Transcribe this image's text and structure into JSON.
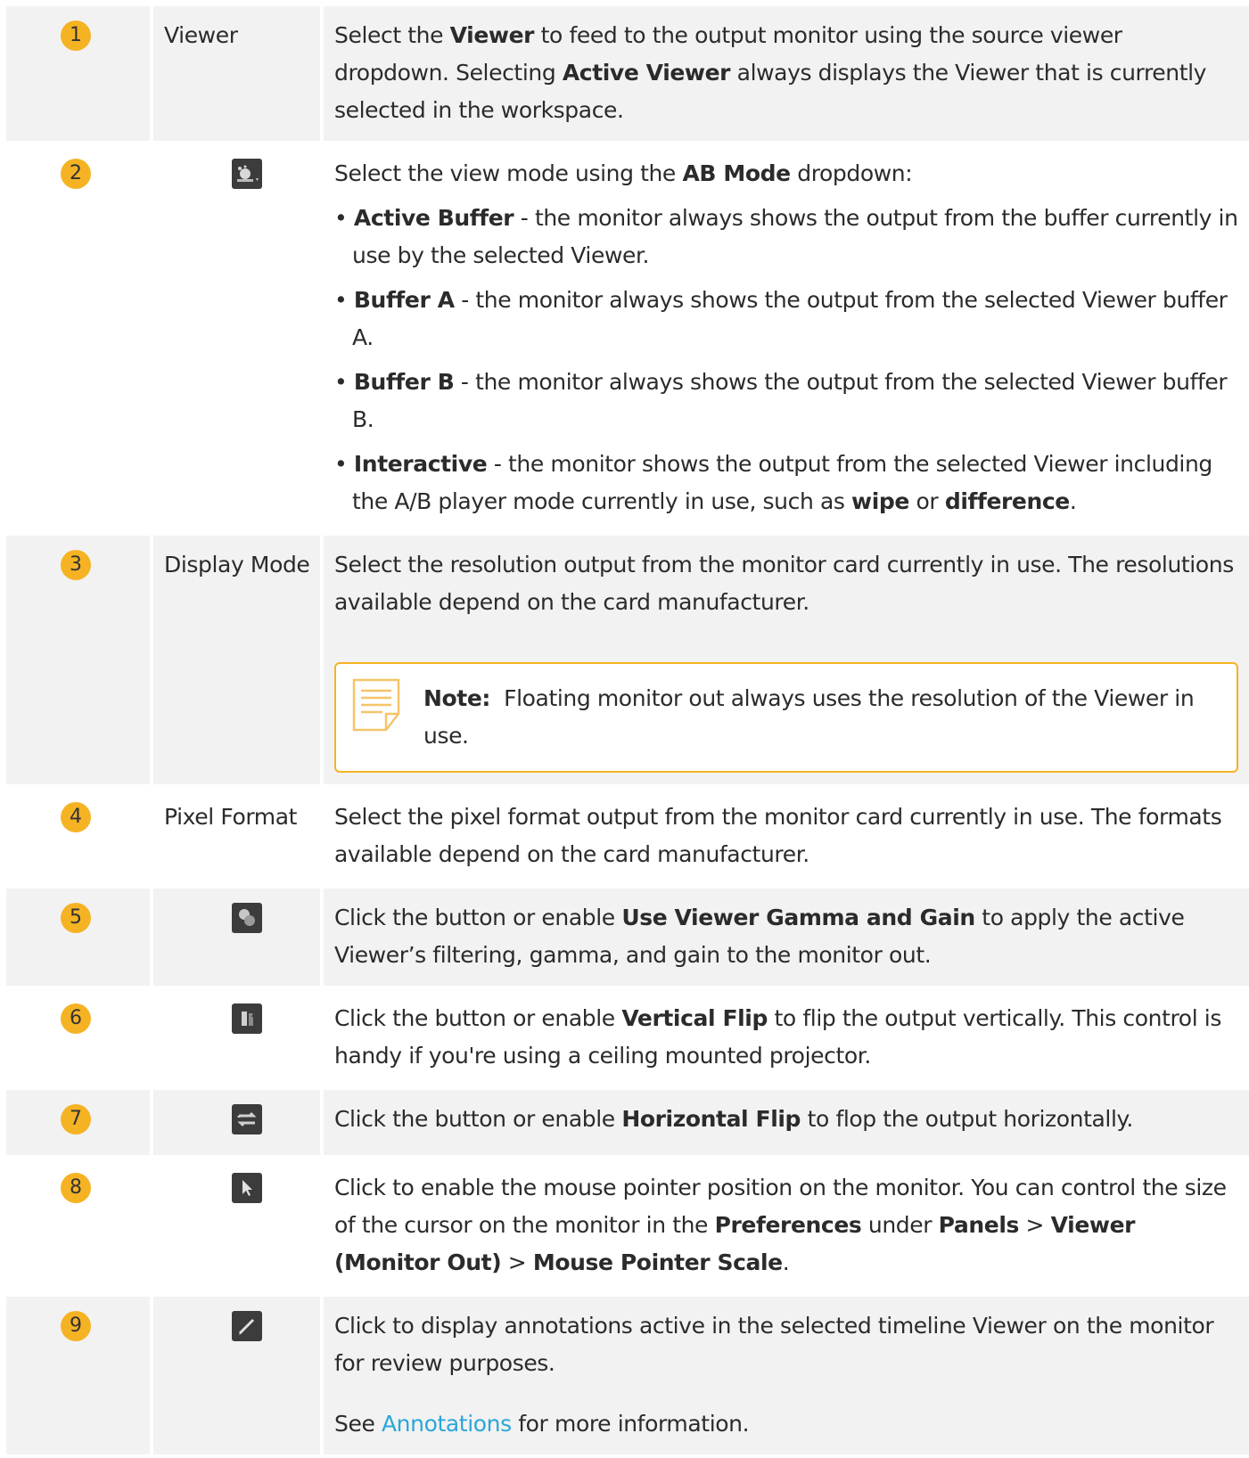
{
  "rows": [
    {
      "number": "1",
      "name": "Viewer",
      "description": [
        {
          "t": "Select the "
        },
        {
          "b": "Viewer"
        },
        {
          "t": " to feed to the output monitor using the source viewer dropdown. Selecting "
        },
        {
          "b": "Active Viewer"
        },
        {
          "t": " always displays the Viewer that is currently selected in the workspace."
        }
      ]
    },
    {
      "number": "2",
      "icon": "ab-mode-icon",
      "intro": [
        {
          "t": "Select the view mode using the "
        },
        {
          "b": "AB Mode"
        },
        {
          "t": " dropdown:"
        }
      ],
      "bullets": [
        [
          {
            "b": "Active Buffer"
          },
          {
            "t": " - the monitor always shows the output from the buffer currently in use by the selected Viewer."
          }
        ],
        [
          {
            "b": "Buffer A"
          },
          {
            "t": " - the monitor always shows the output from the selected Viewer buffer A."
          }
        ],
        [
          {
            "b": "Buffer B"
          },
          {
            "t": " - the monitor always shows the output from the selected Viewer buffer B."
          }
        ],
        [
          {
            "b": "Interactive"
          },
          {
            "t": " - the monitor shows the output from the selected Viewer including the A/B player mode currently in use, such as "
          },
          {
            "b": "wipe"
          },
          {
            "t": " or "
          },
          {
            "b": "difference"
          },
          {
            "t": "."
          }
        ]
      ]
    },
    {
      "number": "3",
      "name": "Display Mode",
      "description": [
        {
          "t": "Select the resolution output from the monitor card currently in use. The resolutions available depend on the card manufacturer."
        }
      ],
      "note": {
        "label": "Note:",
        "text": "  Floating monitor out always uses the resolution of the Viewer in use."
      }
    },
    {
      "number": "4",
      "name": "Pixel Format",
      "description": [
        {
          "t": "Select the pixel format output from the monitor card currently in use. The formats available depend on the card manufacturer."
        }
      ]
    },
    {
      "number": "5",
      "icon": "gamma-gain-icon",
      "description": [
        {
          "t": "Click the button or enable "
        },
        {
          "b": "Use Viewer Gamma and Gain"
        },
        {
          "t": " to apply the active Viewer’s filtering, gamma, and gain to the monitor out."
        }
      ]
    },
    {
      "number": "6",
      "icon": "vertical-flip-icon",
      "description": [
        {
          "t": "Click the button or enable "
        },
        {
          "b": "Vertical Flip"
        },
        {
          "t": " to flip the output vertically. This control is handy if you're using a ceiling mounted projector."
        }
      ]
    },
    {
      "number": "7",
      "icon": "horizontal-flip-icon",
      "description": [
        {
          "t": "Click the button or enable "
        },
        {
          "b": "Horizontal Flip"
        },
        {
          "t": " to flop the output horizontally."
        }
      ]
    },
    {
      "number": "8",
      "icon": "mouse-pointer-icon",
      "description": [
        {
          "t": "Click to enable the mouse pointer position on the monitor. You can control the size of the cursor on the monitor in the "
        },
        {
          "b": "Preferences"
        },
        {
          "t": " under "
        },
        {
          "b": "Panels"
        },
        {
          "t": " > "
        },
        {
          "b": "Viewer (Monitor Out)"
        },
        {
          "t": " > "
        },
        {
          "b": "Mouse Pointer Scale"
        },
        {
          "t": "."
        }
      ]
    },
    {
      "number": "9",
      "icon": "annotations-icon",
      "description": [
        {
          "t": "Click to display annotations active in the selected timeline Viewer on the monitor for review purposes."
        }
      ],
      "see": {
        "before": "See ",
        "link": "Annotations",
        "after": " for more information."
      }
    }
  ],
  "colors": {
    "badge": "#f5b324",
    "row_shade": "#f2f2f2",
    "link": "#2aa6d9",
    "note_border": "#f5b324"
  }
}
